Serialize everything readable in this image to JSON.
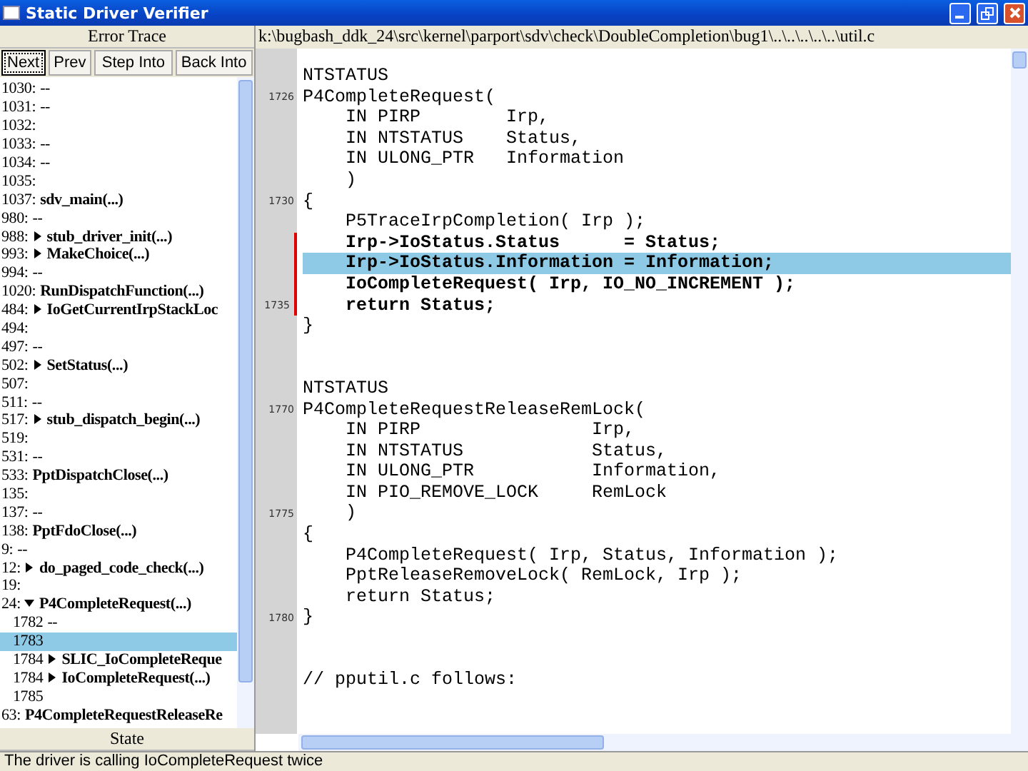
{
  "window": {
    "title": "Static Driver Verifier"
  },
  "trace": {
    "title": "Error Trace",
    "buttons": [
      {
        "label": "Next",
        "selected": true
      },
      {
        "label": "Prev",
        "selected": false
      },
      {
        "label": "Step Into",
        "selected": false
      },
      {
        "label": "Back Into",
        "selected": false
      }
    ],
    "items": [
      {
        "num": "1030:",
        "text": "--",
        "kind": "plain",
        "selected": false
      },
      {
        "num": "1031:",
        "text": "--",
        "kind": "plain",
        "selected": false
      },
      {
        "num": "1032:",
        "selected": false
      },
      {
        "num": "1033:",
        "text": "--",
        "kind": "plain",
        "selected": false
      },
      {
        "num": "1034:",
        "text": "--",
        "kind": "plain",
        "selected": false
      },
      {
        "num": "1035:",
        "selected": false
      },
      {
        "num": "1037:",
        "text": "sdv_main(...)",
        "kind": "call",
        "selected": false
      },
      {
        "num": "980:",
        "text": "--",
        "kind": "plain",
        "selected": false
      },
      {
        "num": "988:",
        "text": "stub_driver_init(...)",
        "kind": "call",
        "expanded": false,
        "selected": false
      },
      {
        "num": "993:",
        "text": "MakeChoice(...)",
        "kind": "call",
        "expanded": false,
        "selected": false
      },
      {
        "num": "994:",
        "text": "--",
        "kind": "plain",
        "selected": false
      },
      {
        "num": "1020:",
        "text": "RunDispatchFunction(...)",
        "kind": "call",
        "selected": false
      },
      {
        "num": "484:",
        "text": "IoGetCurrentIrpStackLoc",
        "kind": "call",
        "expanded": false,
        "selected": false
      },
      {
        "num": "494:",
        "selected": false
      },
      {
        "num": "497:",
        "text": "--",
        "kind": "plain",
        "selected": false
      },
      {
        "num": "502:",
        "text": "SetStatus(...)",
        "kind": "call",
        "expanded": false,
        "selected": false
      },
      {
        "num": "507:",
        "selected": false
      },
      {
        "num": "511:",
        "text": "--",
        "kind": "plain",
        "selected": false
      },
      {
        "num": "517:",
        "text": "stub_dispatch_begin(...)",
        "kind": "call",
        "expanded": false,
        "selected": false
      },
      {
        "num": "519:",
        "selected": false
      },
      {
        "num": "531:",
        "text": "--",
        "kind": "plain",
        "selected": false
      },
      {
        "num": "533:",
        "text": "PptDispatchClose(...)",
        "kind": "call",
        "selected": false
      },
      {
        "num": "135:",
        "selected": false
      },
      {
        "num": "137:",
        "text": "--",
        "kind": "plain",
        "selected": false
      },
      {
        "num": "138:",
        "text": "PptFdoClose(...)",
        "kind": "call",
        "selected": false
      },
      {
        "num": "9:",
        "text": "--",
        "kind": "plain",
        "selected": false
      },
      {
        "num": "12:",
        "text": "do_paged_code_check(...)",
        "kind": "call",
        "expanded": false,
        "selected": false
      },
      {
        "num": "19:",
        "selected": false
      },
      {
        "num": "24:",
        "text": "P4CompleteRequest(...)",
        "kind": "call",
        "expanded": true,
        "selected": false,
        "children": [
          {
            "num": "1782",
            "text": "--",
            "kind": "plain",
            "selected": false
          },
          {
            "num": "1783",
            "selected": true
          },
          {
            "num": "1784",
            "text": "SLIC_IoCompleteReque",
            "kind": "call",
            "expanded": false,
            "selected": false
          },
          {
            "num": "1784",
            "text": "IoCompleteRequest(...)",
            "kind": "call",
            "expanded": false,
            "selected": false
          },
          {
            "num": "1785",
            "selected": false
          }
        ]
      },
      {
        "num": "63:",
        "text": "P4CompleteRequestReleaseRe",
        "kind": "call",
        "selected": false
      }
    ],
    "state_title": "State"
  },
  "editor": {
    "path": "k:\\bugbash_ddk_24\\src\\kernel\\parport\\sdv\\check\\DoubleCompletion\\bug1\\..\\..\\..\\..\\..\\util.c",
    "lines": [
      {
        "kind": "code",
        "text": "NTSTATUS",
        "bold": false,
        "highlighted": false,
        "bracketed": false
      },
      {
        "kind": "code",
        "gutter": "1726",
        "text": "P4CompleteRequest(",
        "bold": false,
        "highlighted": false,
        "bracketed": false
      },
      {
        "kind": "code",
        "text": "    IN PIRP        Irp,",
        "bold": false,
        "highlighted": false,
        "bracketed": false
      },
      {
        "kind": "code",
        "text": "    IN NTSTATUS    Status,",
        "bold": false,
        "highlighted": false,
        "bracketed": false
      },
      {
        "kind": "code",
        "text": "    IN ULONG_PTR   Information",
        "bold": false,
        "highlighted": false,
        "bracketed": false
      },
      {
        "kind": "code",
        "text": "    )",
        "bold": false,
        "highlighted": false,
        "bracketed": false
      },
      {
        "kind": "code",
        "gutter": "1730",
        "text": "{",
        "bold": false,
        "highlighted": false,
        "bracketed": false
      },
      {
        "kind": "code",
        "text": "    P5TraceIrpCompletion( Irp );",
        "bold": false,
        "highlighted": false,
        "bracketed": false
      },
      {
        "kind": "code",
        "text": "    Irp->IoStatus.Status      = Status;",
        "bold": true,
        "highlighted": false,
        "bracketed": true
      },
      {
        "kind": "code",
        "text": "    Irp->IoStatus.Information = Information;",
        "bold": true,
        "highlighted": true,
        "bracketed": true
      },
      {
        "kind": "code",
        "text": "    IoCompleteRequest( Irp, IO_NO_INCREMENT );",
        "bold": true,
        "highlighted": false,
        "bracketed": true
      },
      {
        "kind": "code",
        "gutter": "1735",
        "text": "    return Status;",
        "bold": true,
        "highlighted": false,
        "bracketed": true
      },
      {
        "kind": "code",
        "text": "}",
        "bold": false,
        "highlighted": false,
        "bracketed": false
      },
      {
        "kind": "blank"
      },
      {
        "kind": "blank"
      },
      {
        "kind": "code",
        "text": "NTSTATUS",
        "bold": false,
        "highlighted": false,
        "bracketed": false
      },
      {
        "kind": "code",
        "gutter": "1770",
        "text": "P4CompleteRequestReleaseRemLock(",
        "bold": false,
        "highlighted": false,
        "bracketed": false
      },
      {
        "kind": "code",
        "text": "    IN PIRP                Irp,",
        "bold": false,
        "highlighted": false,
        "bracketed": false
      },
      {
        "kind": "code",
        "text": "    IN NTSTATUS            Status,",
        "bold": false,
        "highlighted": false,
        "bracketed": false
      },
      {
        "kind": "code",
        "text": "    IN ULONG_PTR           Information,",
        "bold": false,
        "highlighted": false,
        "bracketed": false
      },
      {
        "kind": "code",
        "text": "    IN PIO_REMOVE_LOCK     RemLock",
        "bold": false,
        "highlighted": false,
        "bracketed": false
      },
      {
        "kind": "code",
        "gutter": "1775",
        "text": "    )",
        "bold": false,
        "highlighted": false,
        "bracketed": false
      },
      {
        "kind": "code",
        "text": "{",
        "bold": false,
        "highlighted": false,
        "bracketed": false
      },
      {
        "kind": "code",
        "text": "    P4CompleteRequest( Irp, Status, Information );",
        "bold": false,
        "highlighted": false,
        "bracketed": false
      },
      {
        "kind": "code",
        "text": "    PptReleaseRemoveLock( RemLock, Irp );",
        "bold": false,
        "highlighted": false,
        "bracketed": false
      },
      {
        "kind": "code",
        "text": "    return Status;",
        "bold": false,
        "highlighted": false,
        "bracketed": false
      },
      {
        "kind": "code",
        "gutter": "1780",
        "text": "}",
        "bold": false,
        "highlighted": false,
        "bracketed": false
      },
      {
        "kind": "blank"
      },
      {
        "kind": "blank"
      },
      {
        "kind": "code",
        "text": "// pputil.c follows:",
        "bold": false,
        "highlighted": false,
        "bracketed": false
      }
    ]
  },
  "status_bar": "The driver is calling IoCompleteRequest twice"
}
